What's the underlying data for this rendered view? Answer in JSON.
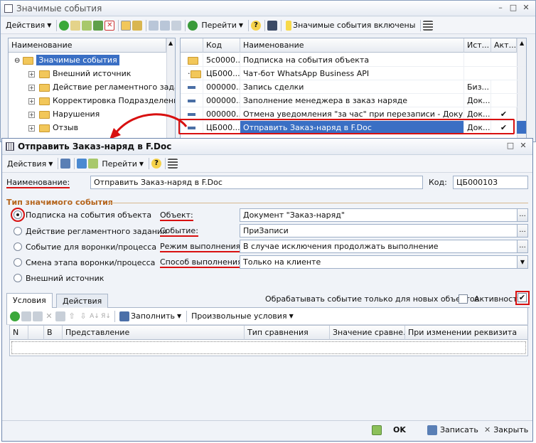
{
  "back_window": {
    "title": "Значимые события",
    "toolbar": {
      "actions_label": "Действия",
      "goto_label": "Перейти",
      "events_enabled_label": "Значимые события включены",
      "help_glyph": "?"
    },
    "tree": {
      "header": "Наименование",
      "items": [
        {
          "label": "Значимые события",
          "selected": true
        },
        {
          "label": "Внешний источник"
        },
        {
          "label": "Действие регламентного задания"
        },
        {
          "label": "Корректировка Подразделени"
        },
        {
          "label": "Нарушения"
        },
        {
          "label": "Отзыв"
        }
      ]
    },
    "list": {
      "columns": [
        "Код",
        "Наименование",
        "Ист...",
        "Акт..."
      ],
      "rows": [
        {
          "code": "5с0000...",
          "name": "Подписка на события объекта",
          "src": "",
          "active": ""
        },
        {
          "code": "ЦБ000...",
          "name": "Чат-бот WhatsApp Business API",
          "src": "",
          "active": ""
        },
        {
          "code": "000000...",
          "name": "Запись сделки",
          "src": "Биз...",
          "active": ""
        },
        {
          "code": "000000...",
          "name": "Заполнение менеджера в заказ наряде",
          "src": "Док...",
          "active": ""
        },
        {
          "code": "000000...",
          "name": "Отмена уведомления \"за час\" при перезаписи - Документ...",
          "src": "Док...",
          "active": "✔"
        },
        {
          "code": "ЦБ000...",
          "name": "Отправить Заказ-наряд в F.Doc",
          "src": "Док...",
          "active": "✔",
          "selected": true
        }
      ]
    }
  },
  "front_window": {
    "title": "Отправить Заказ-наряд в F.Doc",
    "toolbar": {
      "actions_label": "Действия",
      "goto_label": "Перейти",
      "help_glyph": "?"
    },
    "name_label": "Наименование:",
    "name_value": "Отправить Заказ-наряд в F.Doc",
    "code_label": "Код:",
    "code_value": "ЦБ000103",
    "group_title": "Тип значимого события",
    "radios": [
      {
        "label": "Подписка на события объекта",
        "checked": true
      },
      {
        "label": "Действие регламентного задания"
      },
      {
        "label": "Событие для воронки/процесса"
      },
      {
        "label": "Смена этапа воронки/процесса"
      },
      {
        "label": "Внешний источник"
      }
    ],
    "object_label": "Объект:",
    "object_value": "Документ \"Заказ-наряд\"",
    "event_label": "Событие:",
    "event_value": "ПриЗаписи",
    "mode_label": "Режим выполнения:",
    "mode_value": "В случае исключения продолжать выполнение",
    "method_label": "Способ выполнения:",
    "method_value": "Только на клиенте",
    "tabs": [
      "Условия",
      "Действия"
    ],
    "new_objects_label": "Обрабатывать событие только для новых объектов",
    "activity_label": "Активность",
    "activity_checked": true,
    "cond_toolbar": {
      "fill_label": "Заполнить",
      "custom_label": "Произвольные условия"
    },
    "cond_columns": [
      "N",
      "",
      "В",
      "Представление",
      "Тип сравнения",
      "Значение сравне...",
      "При изменении реквизита"
    ],
    "footer": {
      "ok_label": "OK",
      "save_label": "Записать",
      "close_label": "Закрыть"
    }
  },
  "colors": {
    "accent": "#3a6fc4",
    "highlight": "#d81010"
  }
}
